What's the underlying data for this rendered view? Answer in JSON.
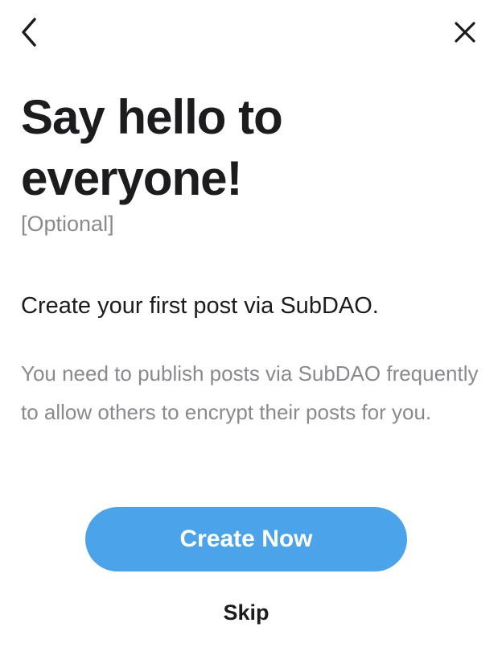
{
  "header": {
    "back_icon": "chevron-left-icon",
    "close_icon": "close-icon"
  },
  "content": {
    "title": "Say hello to everyone!",
    "optional_label": "[Optional]",
    "subtitle": "Create your first post via SubDAO.",
    "description": "You need to publish posts via SubDAO frequently to allow others to encrypt their posts for you."
  },
  "actions": {
    "create_now_label": "Create Now",
    "skip_label": "Skip"
  },
  "colors": {
    "accent": "#4ba3ea",
    "text_primary": "#1c1c1e",
    "text_secondary": "#8a8a8e"
  }
}
